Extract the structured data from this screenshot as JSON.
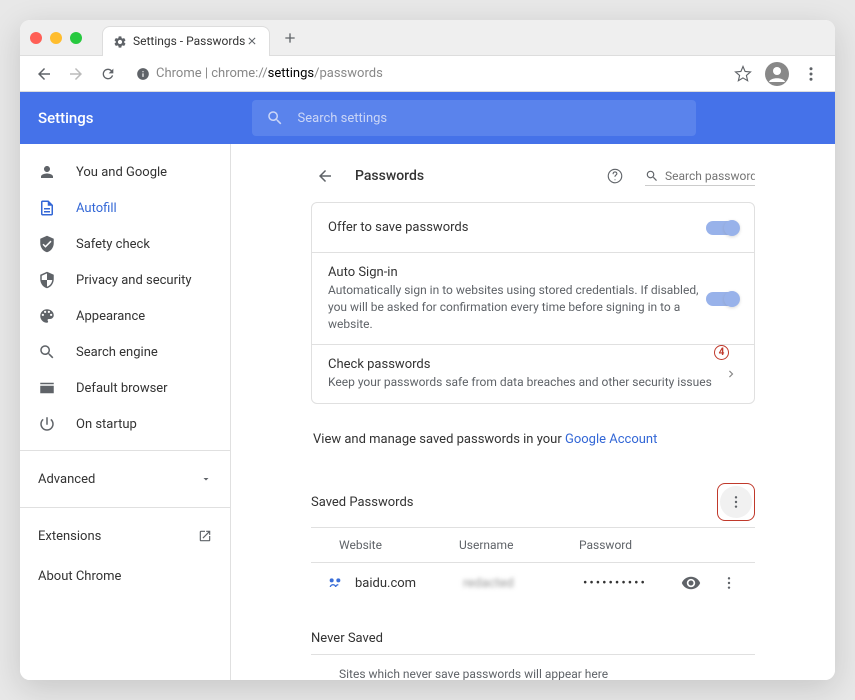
{
  "tab": {
    "title": "Settings - Passwords"
  },
  "url": {
    "prefix": "Chrome | chrome://",
    "bold": "settings",
    "suffix": "/passwords"
  },
  "header": {
    "title": "Settings",
    "search_placeholder": "Search settings"
  },
  "sidebar": {
    "items": [
      {
        "label": "You and Google"
      },
      {
        "label": "Autofill"
      },
      {
        "label": "Safety check"
      },
      {
        "label": "Privacy and security"
      },
      {
        "label": "Appearance"
      },
      {
        "label": "Search engine"
      },
      {
        "label": "Default browser"
      },
      {
        "label": "On startup"
      }
    ],
    "advanced": "Advanced",
    "extensions": "Extensions",
    "about": "About Chrome"
  },
  "page": {
    "title": "Passwords",
    "search_placeholder": "Search passwords",
    "offer_save": "Offer to save passwords",
    "auto_signin_title": "Auto Sign-in",
    "auto_signin_desc": "Automatically sign in to websites using stored credentials. If disabled, you will be asked for confirmation every time before signing in to a website.",
    "check_title": "Check passwords",
    "check_desc": "Keep your passwords safe from data breaches and other security issues",
    "view_prefix": "View and manage saved passwords in your ",
    "view_link": "Google Account"
  },
  "saved": {
    "title": "Saved Passwords",
    "cols": {
      "website": "Website",
      "username": "Username",
      "password": "Password"
    },
    "rows": [
      {
        "site": "baidu.com",
        "username": "redacted",
        "password": "••••••••••"
      }
    ]
  },
  "never": {
    "title": "Never Saved",
    "empty": "Sites which never save passwords will appear here"
  },
  "annotation": {
    "label": "4"
  }
}
